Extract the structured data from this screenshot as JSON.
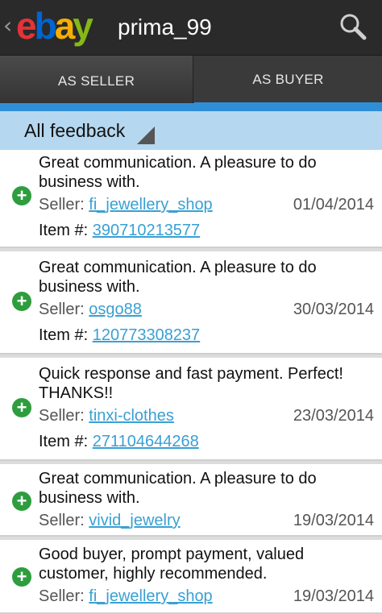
{
  "header": {
    "logo_text": "ebay",
    "username": "prima_99",
    "back_glyph": "‹",
    "search_icon": "search-icon"
  },
  "tabs": [
    {
      "label": "AS SELLER"
    },
    {
      "label": "AS BUYER"
    }
  ],
  "filter": {
    "label": "All feedback"
  },
  "feedback": [
    {
      "comment": "Great communication. A pleasure to do business with.",
      "seller_label": "Seller:",
      "seller": "fi_jewellery_shop",
      "date": "01/04/2014",
      "item_label": "Item #:",
      "item": "390710213577"
    },
    {
      "comment": "Great communication. A pleasure to do business with.",
      "seller_label": "Seller:",
      "seller": "osgo88",
      "date": "30/03/2014",
      "item_label": "Item #:",
      "item": "120773308237"
    },
    {
      "comment": "Quick response and fast payment. Perfect! THANKS!!",
      "seller_label": "Seller:",
      "seller": "tinxi-clothes",
      "date": "23/03/2014",
      "item_label": "Item #:",
      "item": "271104644268"
    },
    {
      "comment": "Great communication. A pleasure to do business with.",
      "seller_label": "Seller:",
      "seller": "vivid_jewelry",
      "date": "19/03/2014"
    },
    {
      "comment": "Good buyer, prompt payment, valued customer, highly recommended.",
      "seller_label": "Seller:",
      "seller": "fi_jewellery_shop",
      "date": "19/03/2014"
    }
  ],
  "colors": {
    "ebay_e": "#e53238",
    "ebay_b": "#0064d2",
    "ebay_a": "#f5af02",
    "ebay_y": "#86b817",
    "accent": "#2f8fd6",
    "positive": "#2e9d3e",
    "link": "#39a0d3"
  }
}
